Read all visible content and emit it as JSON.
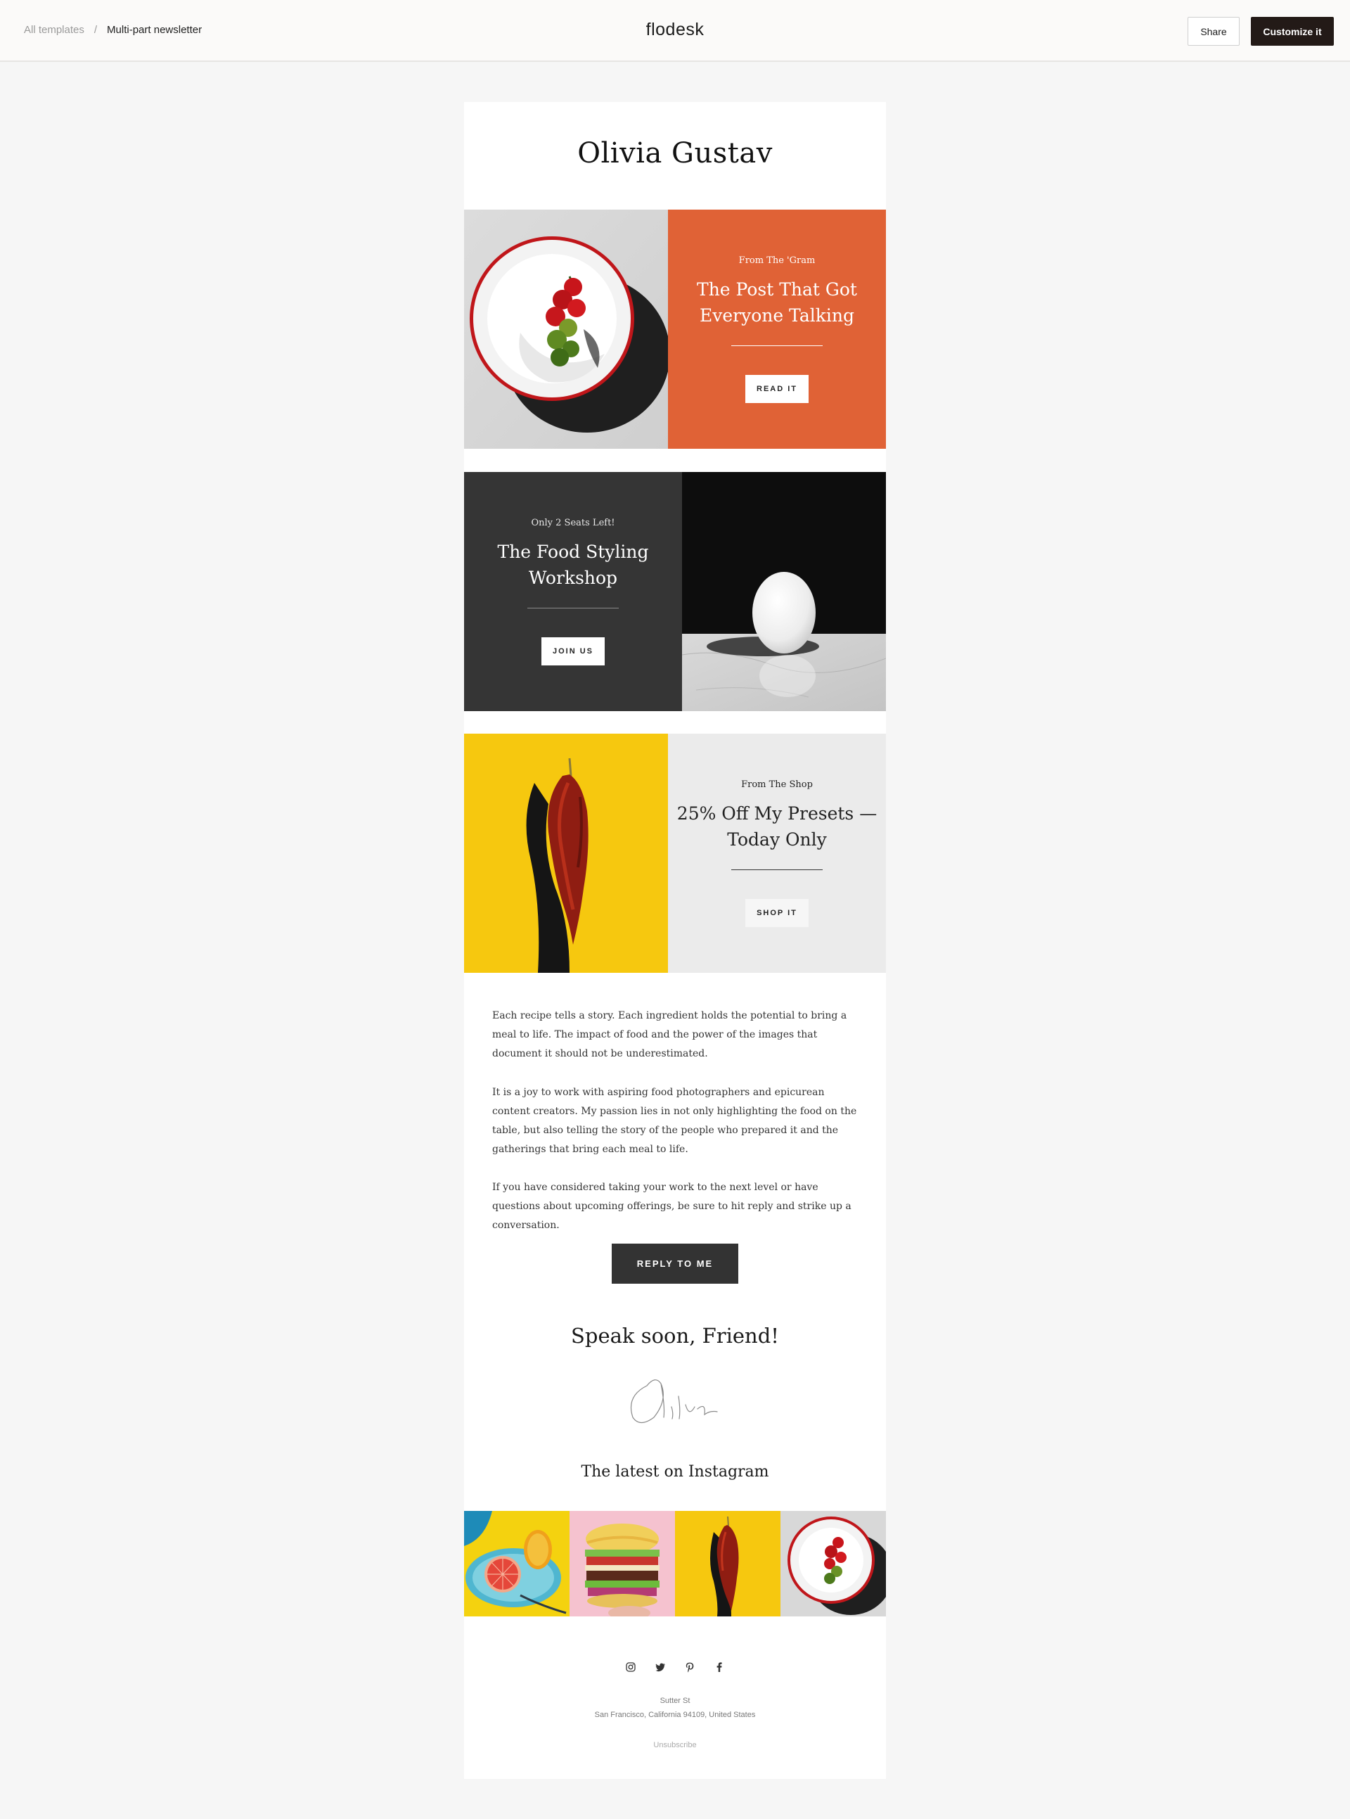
{
  "topbar": {
    "breadcrumb_parent": "All templates",
    "breadcrumb_sep": "/",
    "breadcrumb_current": "Multi-part newsletter",
    "brand": "flodesk",
    "share_label": "Share",
    "customize_label": "Customize it"
  },
  "email": {
    "author": "Olivia Gustav",
    "blocks": [
      {
        "eyebrow": "From The 'Gram",
        "headline": "The Post That Got Everyone Talking",
        "cta": "READ IT",
        "bg": "#e06236",
        "image": "tomato-plate-photo"
      },
      {
        "eyebrow": "Only 2 Seats Left!",
        "headline": "The Food Styling Workshop",
        "cta": "JOIN US",
        "bg": "#353535",
        "image": "egg-photo"
      },
      {
        "eyebrow": "From The Shop",
        "headline": "25% Off My Presets —Today Only",
        "cta": "SHOP IT",
        "bg": "#ebebeb",
        "image": "chili-pepper-photo"
      }
    ],
    "paragraphs": [
      "Each recipe tells a story. Each ingredient holds the potential to bring a meal to life. The impact of food and the power of the images that document it should not be underestimated.",
      "It is a joy to work with aspiring food photographers and epicurean content creators. My passion lies in not only highlighting the food on the table, but also telling the story of the people who prepared it and the gatherings that bring each meal to life.",
      "If you have considered taking your work to the next level or have questions about upcoming offerings, be sure to hit reply and strike up a conversation."
    ],
    "reply_label": "REPLY TO ME",
    "signoff": "Speak soon, Friend!",
    "signature": "Olivia",
    "instagram_title": "The latest on Instagram",
    "instagram_images": [
      "grapefruit-photo",
      "burger-photo",
      "chili-pepper-photo",
      "tomato-plate-photo"
    ],
    "social_icons": [
      "instagram-icon",
      "twitter-icon",
      "pinterest-icon",
      "facebook-icon"
    ],
    "address_line1": "Sutter St",
    "address_line2": "San Francisco, California 94109, United States",
    "unsubscribe": "Unsubscribe"
  },
  "colors": {
    "page_bg": "#f6f6f6",
    "orange": "#e06236",
    "charcoal": "#353535",
    "light_gray": "#ebebeb",
    "yellow": "#f6c80f",
    "customize_button": "#231a17"
  }
}
